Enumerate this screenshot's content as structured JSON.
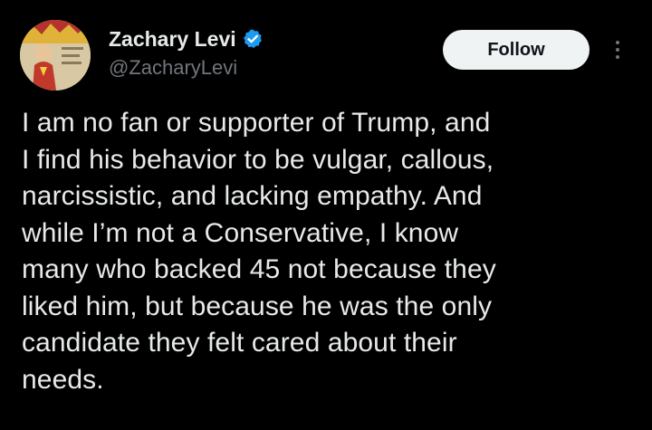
{
  "author": {
    "display_name": "Zachary Levi",
    "handle": "@ZacharyLevi",
    "verified": true,
    "verified_icon": "verified-badge-icon",
    "avatar_icon": "avatar-image"
  },
  "actions": {
    "follow_label": "Follow",
    "more_icon": "more-vertical-icon"
  },
  "tweet": {
    "text": "I am no fan or supporter of Trump, and\nI find his behavior to be vulgar, callous,\nnarcissistic, and lacking empathy. And\nwhile I’m not a Conservative, I know\nmany who backed 45 not because they\nliked him, but because he was the only\ncandidate they felt cared about their\nneeds."
  },
  "colors": {
    "background": "#000000",
    "text_primary": "#e7e9ea",
    "text_secondary": "#71767b",
    "verified_blue": "#1d9bf0",
    "follow_button_bg": "#eff3f4"
  }
}
